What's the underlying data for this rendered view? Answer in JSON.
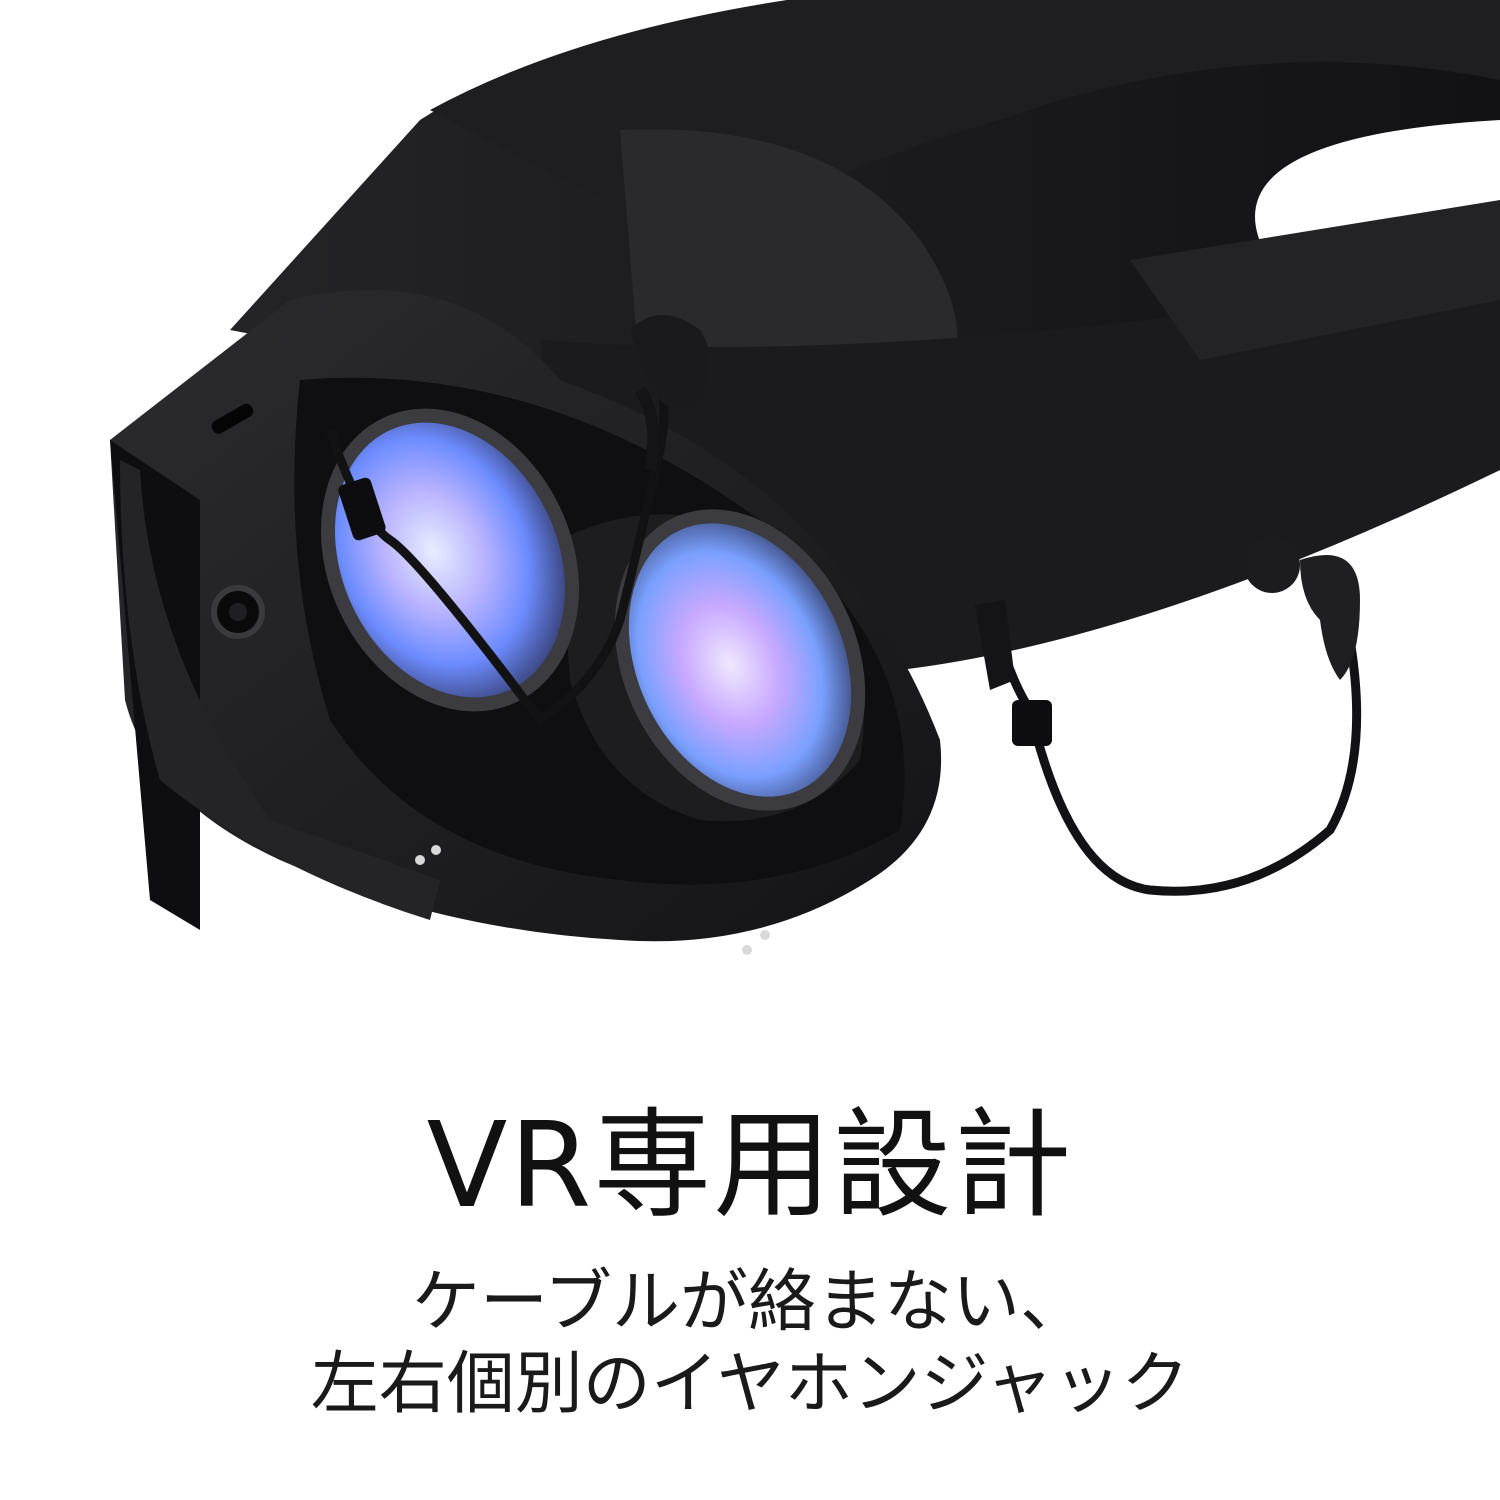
{
  "headline": "VR専用設計",
  "subtext": {
    "line1": "ケーブルが絡まない、",
    "line2": "左右個別のイヤホンジャック"
  },
  "colors": {
    "background": "#ffffff",
    "headset": "#1c1c1e",
    "text": "#111111",
    "lens_glow": "#8fb3ff"
  }
}
